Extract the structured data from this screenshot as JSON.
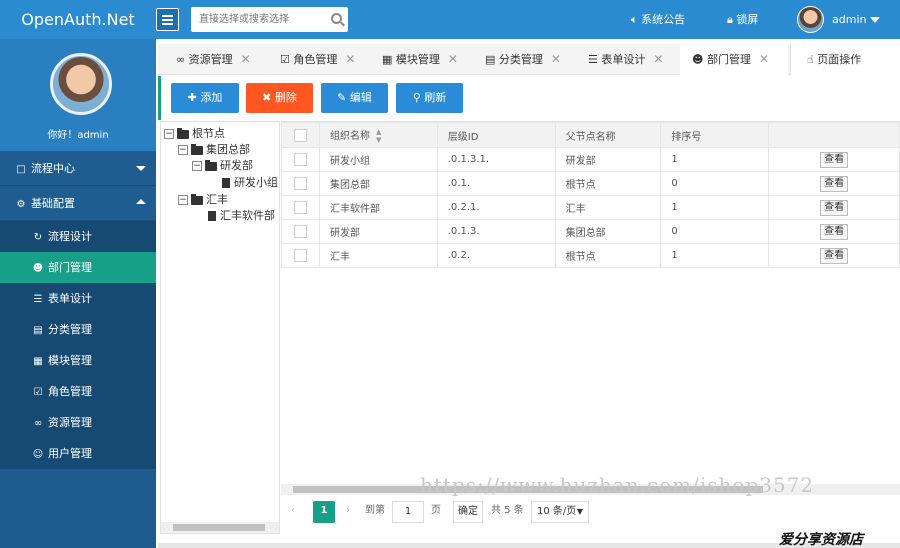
{
  "header": {
    "logo": "OpenAuth.Net",
    "search_placeholder": "直接选择或搜索选择",
    "notice": "系统公告",
    "lock": "锁屏",
    "user": "admin"
  },
  "sidebar": {
    "greeting": "你好！admin",
    "groups": [
      {
        "label": "流程中心",
        "expanded": false
      },
      {
        "label": "基础配置",
        "expanded": true
      }
    ],
    "items": [
      {
        "label": "流程设计",
        "icon": "flow-icon"
      },
      {
        "label": "部门管理",
        "icon": "users-icon",
        "active": true
      },
      {
        "label": "表单设计",
        "icon": "form-icon"
      },
      {
        "label": "分类管理",
        "icon": "category-icon"
      },
      {
        "label": "模块管理",
        "icon": "module-icon"
      },
      {
        "label": "角色管理",
        "icon": "role-icon"
      },
      {
        "label": "资源管理",
        "icon": "link-icon"
      },
      {
        "label": "用户管理",
        "icon": "user-icon"
      }
    ]
  },
  "tabs": [
    {
      "label": "资源管理",
      "icon": "link-icon"
    },
    {
      "label": "角色管理",
      "icon": "checkbox-icon"
    },
    {
      "label": "模块管理",
      "icon": "module-icon"
    },
    {
      "label": "分类管理",
      "icon": "category-icon"
    },
    {
      "label": "表单设计",
      "icon": "form-icon"
    },
    {
      "label": "部门管理",
      "icon": "users-icon",
      "active": true
    },
    {
      "label": "页面操作",
      "icon": "hand-icon"
    }
  ],
  "toolbar": {
    "add": "添加",
    "delete": "删除",
    "edit": "编辑",
    "refresh": "刷新",
    "colors": {
      "primary": "#2a8bd6",
      "danger": "#ff5722",
      "accent": "#17a087"
    }
  },
  "tree": {
    "root": "根节点",
    "n1": "集团总部",
    "n1_1": "研发部",
    "n1_1_1": "研发小组",
    "n2": "汇丰",
    "n2_1": "汇丰软件部"
  },
  "table": {
    "headers": [
      "组织名称",
      "层级ID",
      "父节点名称",
      "排序号"
    ],
    "view_label": "查看",
    "rows": [
      {
        "name": "研发小组",
        "cascade": ".0.1.3.1.",
        "parent": "研发部",
        "sort": "1"
      },
      {
        "name": "集团总部",
        "cascade": ".0.1.",
        "parent": "根节点",
        "sort": "0"
      },
      {
        "name": "汇丰软件部",
        "cascade": ".0.2.1.",
        "parent": "汇丰",
        "sort": "1"
      },
      {
        "name": "研发部",
        "cascade": ".0.1.3.",
        "parent": "集团总部",
        "sort": "0"
      },
      {
        "name": "汇丰",
        "cascade": ".0.2.",
        "parent": "根节点",
        "sort": "1"
      }
    ]
  },
  "pager": {
    "current": "1",
    "goto_label": "到第",
    "goto_value": "1",
    "page_unit": "页",
    "confirm": "确定",
    "total": "共 5 条",
    "page_size": "10 条/页"
  },
  "watermark": "https://www.huzhan.com/ishop3572",
  "footer_brand": "爱分享资源店"
}
